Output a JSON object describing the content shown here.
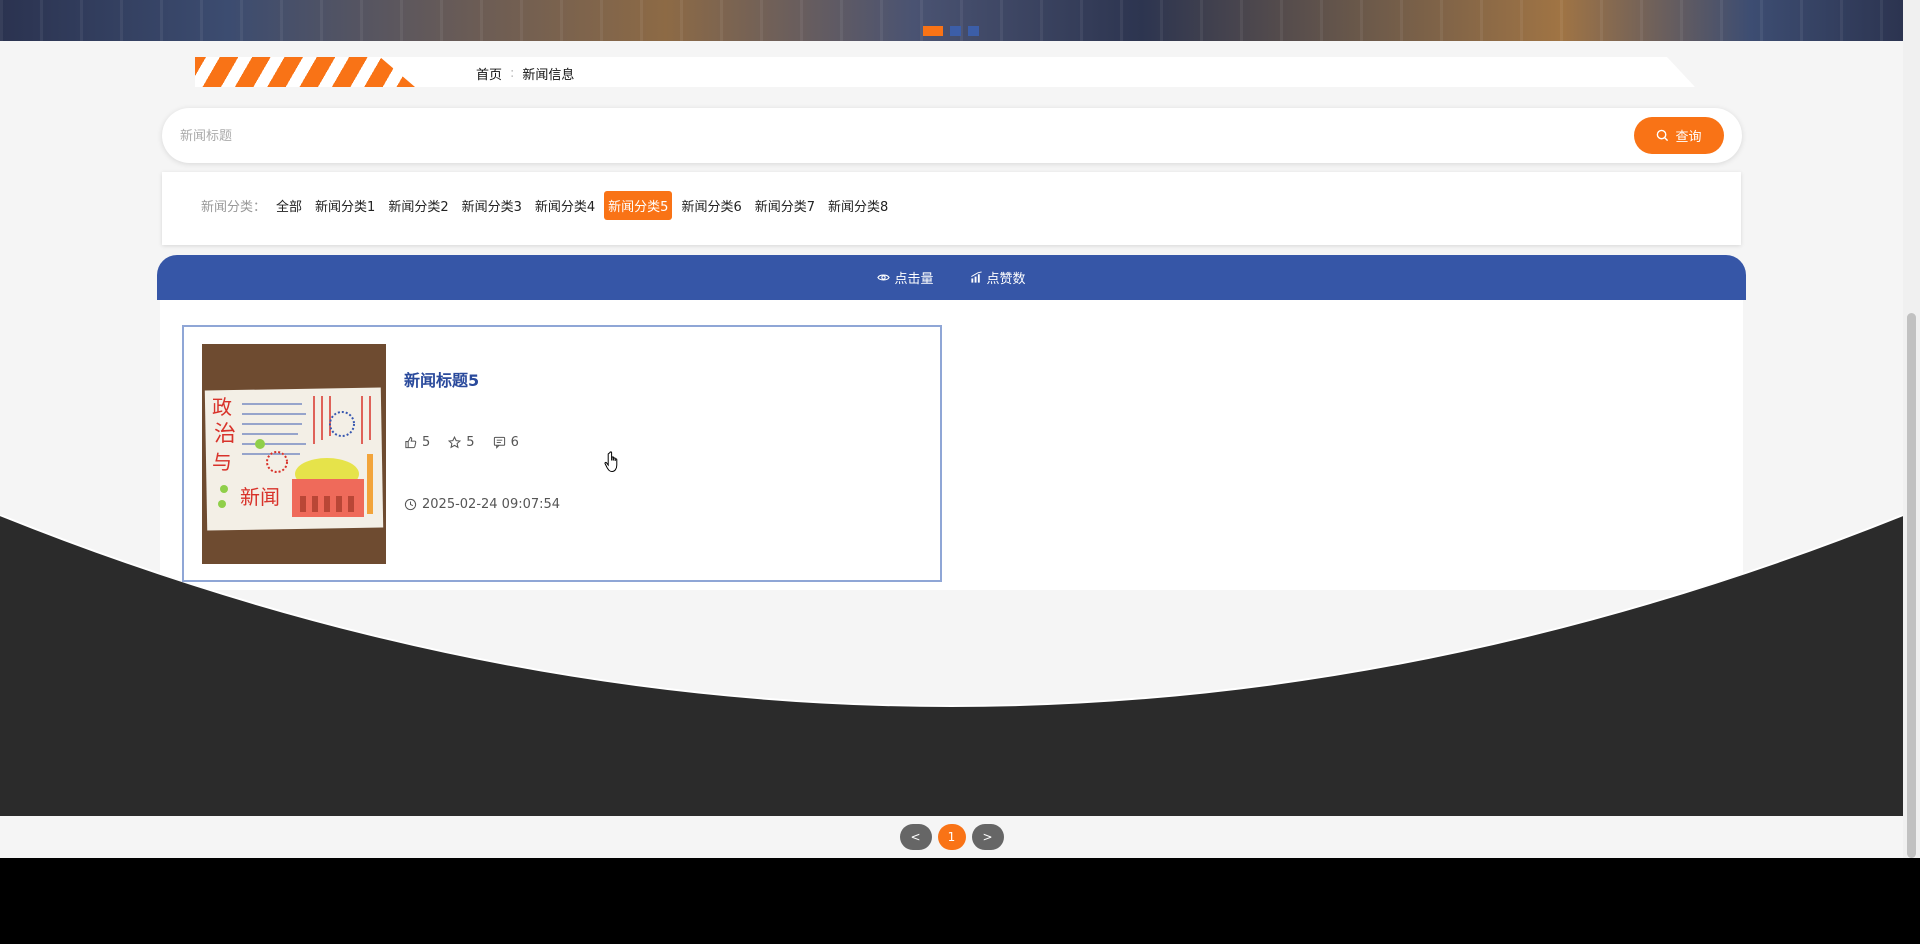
{
  "banner": {
    "dots": [
      "slide-1",
      "slide-2",
      "slide-3"
    ],
    "active_dot": 0
  },
  "breadcrumb": {
    "home": "首页",
    "current": "新闻信息"
  },
  "search": {
    "placeholder": "新闻标题",
    "value": "",
    "button_label": "查询",
    "button_icon": "search-icon"
  },
  "categories": {
    "label": "新闻分类：",
    "items": [
      "全部",
      "新闻分类1",
      "新闻分类2",
      "新闻分类3",
      "新闻分类4",
      "新闻分类5",
      "新闻分类6",
      "新闻分类7",
      "新闻分类8"
    ],
    "active_index": 5
  },
  "sort": {
    "views_label": "点击量",
    "views_icon": "eye-icon",
    "likes_label": "点赞数",
    "likes_icon": "bar-chart-icon"
  },
  "news": [
    {
      "title": "新闻标题5",
      "likes": "5",
      "favorites": "5",
      "comments": "6",
      "date": "2025-02-24 09:07:54",
      "thumbnail": "hand-drawn poster image"
    }
  ],
  "pagination": {
    "prev": "<",
    "current": "1",
    "next": ">"
  },
  "colors": {
    "accent": "#f97316",
    "primary": "#3656a7",
    "dark": "#2b2b2b"
  }
}
